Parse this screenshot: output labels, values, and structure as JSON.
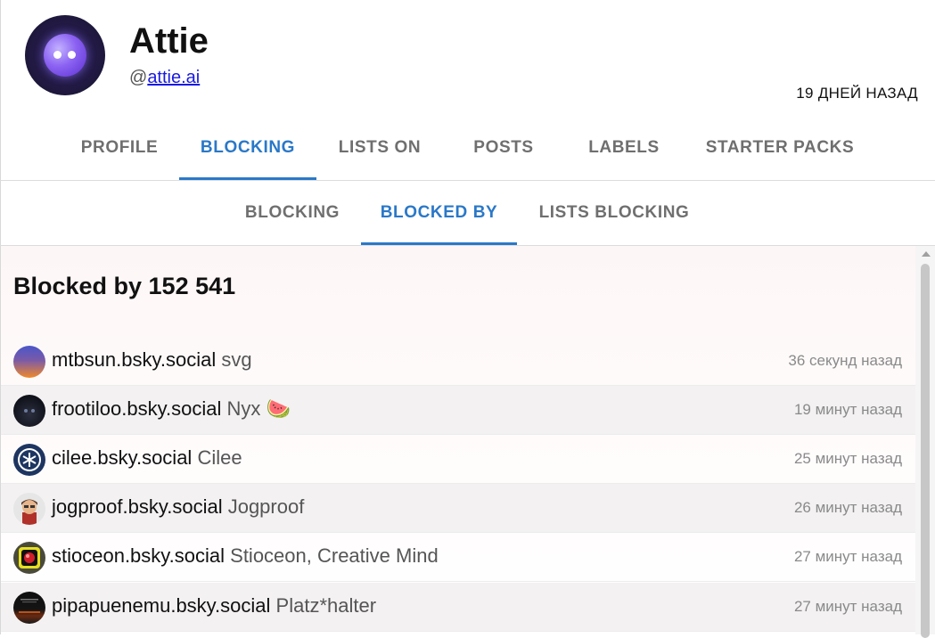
{
  "profile": {
    "name": "Attie",
    "handle_prefix": "@",
    "handle": "attie.ai",
    "age": "19 ДНЕЙ НАЗАД"
  },
  "tabs": [
    {
      "label": "PROFILE"
    },
    {
      "label": "BLOCKING"
    },
    {
      "label": "LISTS ON"
    },
    {
      "label": "POSTS"
    },
    {
      "label": "LABELS"
    },
    {
      "label": "STARTER PACKS"
    }
  ],
  "active_tab": "BLOCKING",
  "subtabs": [
    {
      "label": "BLOCKING"
    },
    {
      "label": "BLOCKED BY"
    },
    {
      "label": "LISTS BLOCKING"
    }
  ],
  "active_subtab": "BLOCKED BY",
  "list": {
    "heading": "Blocked by 152 541",
    "rows": [
      {
        "handle": "mtbsun.bsky.social",
        "display": "svg",
        "time": "36 секунд назад",
        "avatar": "sunset-avatar"
      },
      {
        "handle": "frootiloo.bsky.social",
        "display": "Nyx 🍉",
        "time": "19 минут назад",
        "avatar": "dark-creature-avatar"
      },
      {
        "handle": "cilee.bsky.social",
        "display": "Cilee",
        "time": "25 минут назад",
        "avatar": "asterisk-badge-avatar"
      },
      {
        "handle": "jogproof.bsky.social",
        "display": "Jogproof",
        "time": "26 минут назад",
        "avatar": "cartoon-person-avatar"
      },
      {
        "handle": "stioceon.bsky.social",
        "display": "Stioceon, Creative Mind",
        "time": "27 минут назад",
        "avatar": "camera-lens-avatar"
      },
      {
        "handle": "pipapuenemu.bsky.social",
        "display": "Platz*halter",
        "time": "27 минут назад",
        "avatar": "night-scene-avatar"
      }
    ]
  },
  "colors": {
    "accent": "#2a78c8",
    "tab_inactive": "#6f6f6f",
    "row_shade": "#f3f1f1",
    "time_text": "#8a8a8a"
  }
}
